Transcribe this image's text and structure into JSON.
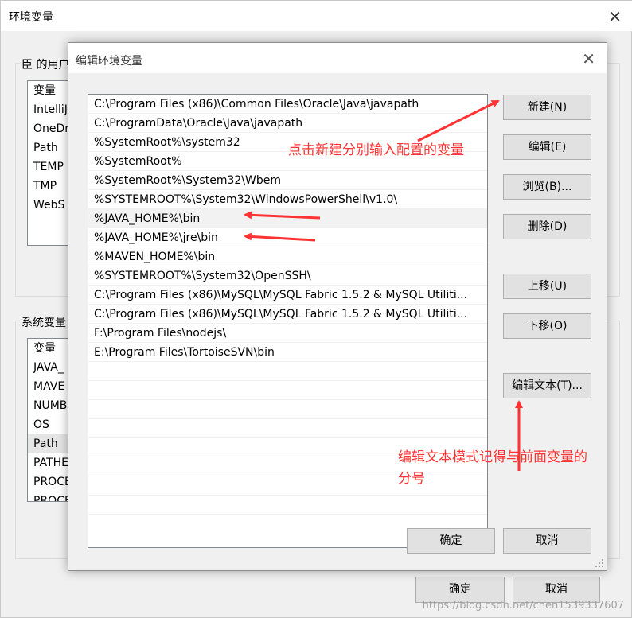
{
  "background_window": {
    "title": "环境变量",
    "close_glyph": "✕",
    "user_vars_label": "臣 的用户",
    "user_vars_header": "变量",
    "user_vars": [
      "IntelliJ",
      "OneDr",
      "Path",
      "TEMP",
      "TMP",
      "WebS"
    ],
    "system_vars_label": "系统变量",
    "system_vars_header": "变量",
    "system_vars": [
      "JAVA_",
      "MAVE",
      "NUMB",
      "OS",
      "Path",
      "PATHE",
      "PROCE",
      "PROCE"
    ],
    "ok_label": "确定",
    "cancel_label": "取消"
  },
  "dialog": {
    "title": "编辑环境变量",
    "close_glyph": "✕",
    "paths": [
      "C:\\Program Files (x86)\\Common Files\\Oracle\\Java\\javapath",
      "C:\\ProgramData\\Oracle\\Java\\javapath",
      "%SystemRoot%\\system32",
      "%SystemRoot%",
      "%SystemRoot%\\System32\\Wbem",
      "%SYSTEMROOT%\\System32\\WindowsPowerShell\\v1.0\\",
      "%JAVA_HOME%\\bin",
      "%JAVA_HOME%\\jre\\bin",
      "%MAVEN_HOME%\\bin",
      "%SYSTEMROOT%\\System32\\OpenSSH\\",
      "C:\\Program Files (x86)\\MySQL\\MySQL Fabric 1.5.2 & MySQL Utiliti...",
      "C:\\Program Files (x86)\\MySQL\\MySQL Fabric 1.5.2 & MySQL Utiliti...",
      "F:\\Program Files\\nodejs\\",
      "E:\\Program Files\\TortoiseSVN\\bin"
    ],
    "buttons": {
      "new": "新建(N)",
      "edit": "编辑(E)",
      "browse": "浏览(B)...",
      "delete": "删除(D)",
      "move_up": "上移(U)",
      "move_down": "下移(O)",
      "edit_text": "编辑文本(T)...",
      "ok": "确定",
      "cancel": "取消"
    }
  },
  "annotations": {
    "new_hint": "点击新建分别输入配置的变量",
    "edit_text_hint_line1": "编辑文本模式记得与前面变量的",
    "edit_text_hint_line2": "分号"
  },
  "watermark": "https://blog.csdn.net/chen1539337607",
  "colors": {
    "annotation": "#ff3333",
    "button_bg": "#e1e1e1",
    "button_border": "#adadad"
  }
}
